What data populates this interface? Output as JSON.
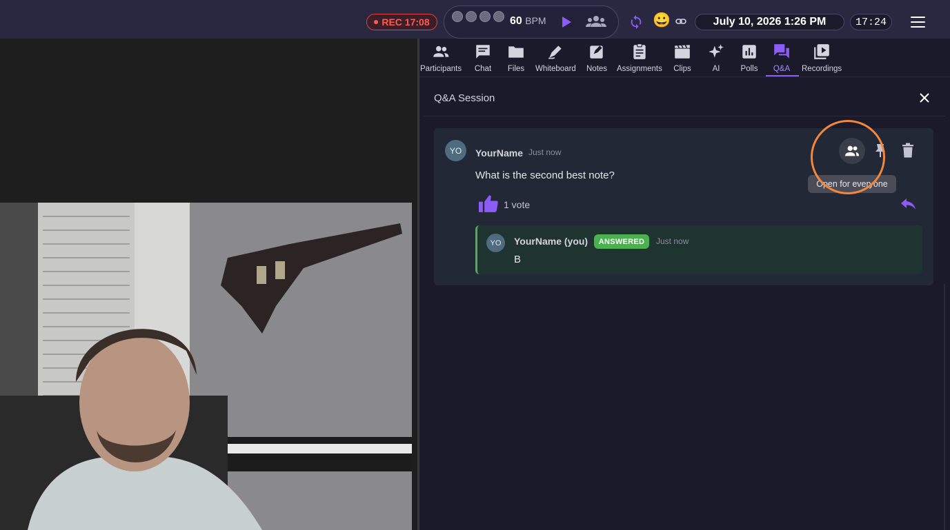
{
  "topbar": {
    "rec_label": "REC 17:08",
    "bpm_value": "60",
    "bpm_unit": "BPM",
    "emoji": "😀",
    "date": "July 10, 2026 1:26 PM",
    "clock": "17:24",
    "accent_color": "#8b5cf6",
    "rec_color": "#ff5a52"
  },
  "tabs": [
    {
      "label": "Participants",
      "icon": "participants-icon"
    },
    {
      "label": "Chat",
      "icon": "chat-icon"
    },
    {
      "label": "Files",
      "icon": "folder-icon"
    },
    {
      "label": "Whiteboard",
      "icon": "whiteboard-icon"
    },
    {
      "label": "Notes",
      "icon": "notes-icon"
    },
    {
      "label": "Assignments",
      "icon": "assignments-icon"
    },
    {
      "label": "Clips",
      "icon": "clips-icon"
    },
    {
      "label": "AI",
      "icon": "sparkle-icon"
    },
    {
      "label": "Polls",
      "icon": "polls-icon"
    },
    {
      "label": "Q&A",
      "icon": "qa-icon",
      "active": true
    },
    {
      "label": "Recordings",
      "icon": "recordings-icon"
    }
  ],
  "qa": {
    "title": "Q&A Session",
    "question": {
      "avatar_initials": "YO",
      "author": "YourName",
      "time": "Just now",
      "text": "What is the second best note?",
      "votes": "1 vote",
      "tooltip": "Open for everyone"
    },
    "answer": {
      "avatar_initials": "YO",
      "author": "YourName (you)",
      "badge": "ANSWERED",
      "time": "Just now",
      "text": "B"
    }
  }
}
